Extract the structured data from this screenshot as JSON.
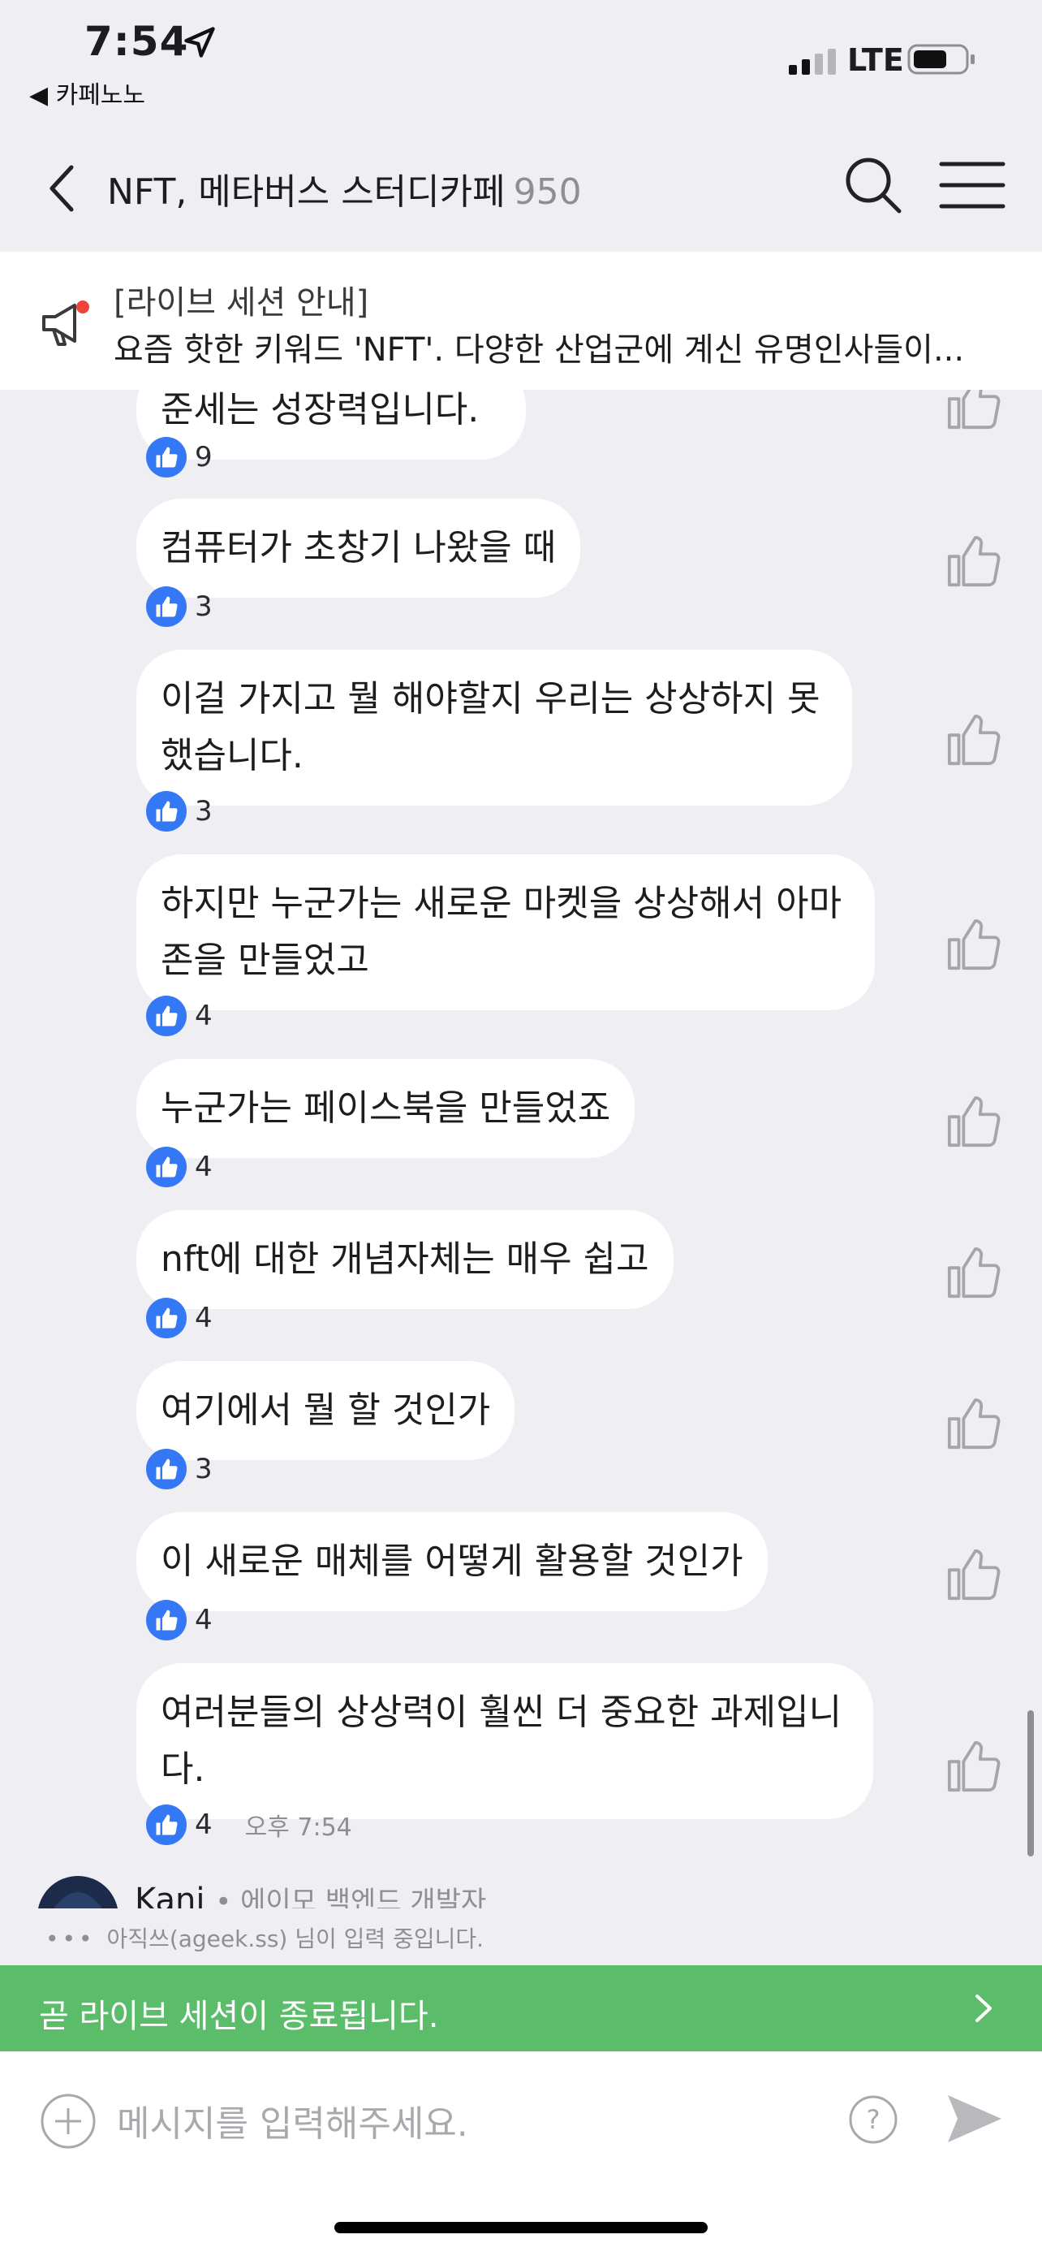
{
  "status_bar": {
    "time": "7:54",
    "back_app": "◀ 카페노노",
    "network": "LTE"
  },
  "header": {
    "title": "NFT, 메타버스 스터디카페",
    "member_count": "950"
  },
  "notice": {
    "title": "[라이브 세션 안내]",
    "body": "요즘 핫한 키워드 'NFT'. 다양한 산업군에 계신 유명인사들이..."
  },
  "messages": [
    {
      "text": "준세는 성장력입니다.",
      "likes": "9"
    },
    {
      "text": "컴퓨터가 초창기 나왔을 때",
      "likes": "3"
    },
    {
      "text": "이걸 가지고 뭘 해야할지 우리는 상상하지 못했습니다.",
      "likes": "3"
    },
    {
      "text": "하지만 누군가는 새로운 마켓을 상상해서 아마존을 만들었고",
      "likes": "4"
    },
    {
      "text": "누군가는 페이스북을 만들었죠",
      "likes": "4"
    },
    {
      "text": "nft에 대한 개념자체는 매우 쉽고",
      "likes": "4"
    },
    {
      "text": "여기에서 뭘 할 것인가",
      "likes": "3"
    },
    {
      "text": "이 새로운 매체를 어떻게 활용할 것인가",
      "likes": "4"
    },
    {
      "text": "여러분들의 상상력이 훨씬 더 중요한 과제입니다.",
      "likes": "4",
      "time": "오후 7:54"
    }
  ],
  "next_user": {
    "name": "Kani",
    "role": "• 에이모 백엔드 개발자"
  },
  "typing_indicator": "아직쓰(ageek.ss) 님이 입력 중입니다.",
  "live_banner": {
    "text": "곧 라이브 세션이 종료됩니다."
  },
  "input": {
    "placeholder": "메시지를 입력해주세요."
  },
  "colors": {
    "background": "#eeeef3",
    "like_badge": "#3478f6",
    "live_banner": "#5bbd6a",
    "bubble": "#ffffff"
  },
  "icons": [
    "location-arrow-icon",
    "signal-icon",
    "battery-icon",
    "back-chevron-icon",
    "search-icon",
    "menu-icon",
    "megaphone-icon",
    "thumbs-up-icon",
    "chevron-right-icon",
    "plus-icon",
    "help-icon",
    "send-icon"
  ]
}
